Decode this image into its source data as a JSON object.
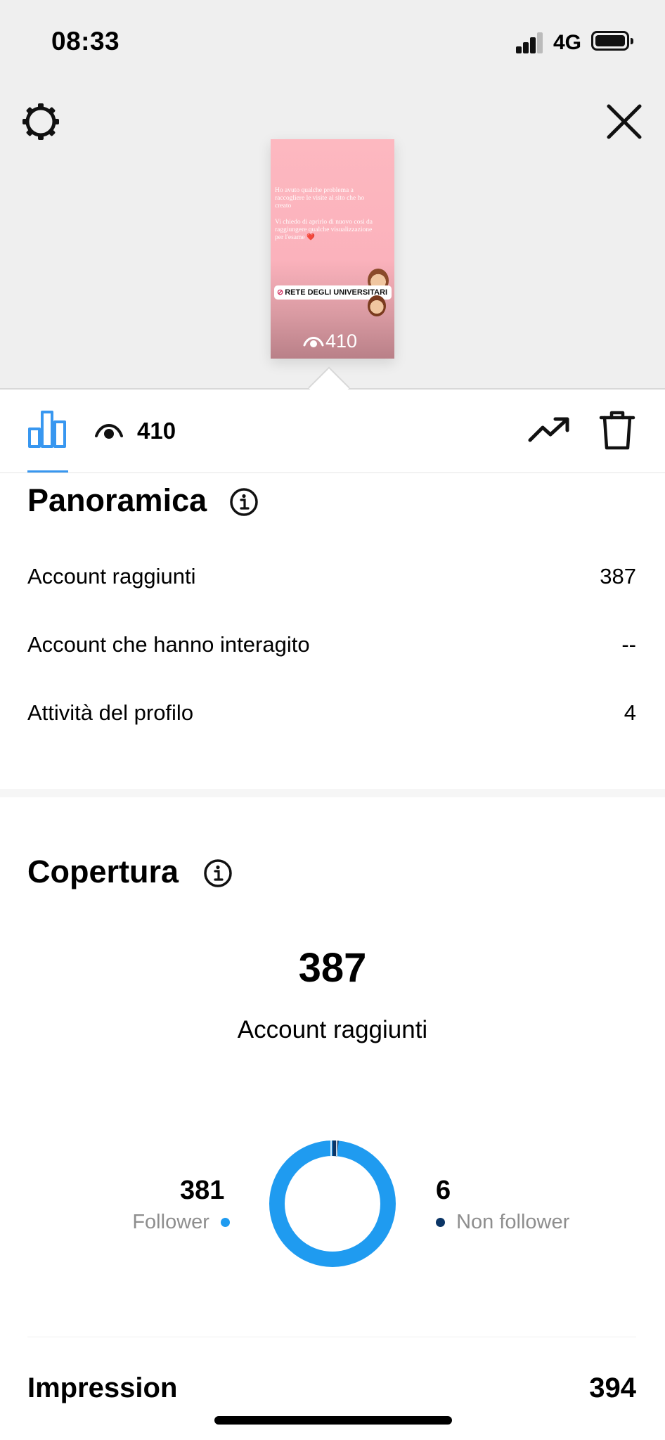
{
  "status_bar": {
    "time": "08:33",
    "network": "4G"
  },
  "story": {
    "text_lines": [
      "Ho avuto qualche problema a raccogliere le visite al sito che ho creato",
      "Vi chiedo di aprirlo di nuovo così da raggiungere qualche visualizzazione per l'esame ❤️"
    ],
    "sticker": "RETE DEGLI UNIVERSITARI",
    "views": "410"
  },
  "tabbar": {
    "views": "410"
  },
  "overview": {
    "title": "Panoramica",
    "rows": [
      {
        "label": "Account raggiunti",
        "value": "387"
      },
      {
        "label": "Account che hanno interagito",
        "value": "--"
      },
      {
        "label": "Attività del profilo",
        "value": "4"
      }
    ]
  },
  "reach": {
    "title": "Copertura",
    "total": "387",
    "total_label": "Account raggiunti",
    "followers": {
      "value": "381",
      "label": "Follower",
      "color": "#1f9bf0"
    },
    "non_followers": {
      "value": "6",
      "label": "Non follower",
      "color": "#0b3566"
    },
    "follower_fraction": 0.9845
  },
  "impressions": {
    "label": "Impression",
    "value": "394"
  },
  "colors": {
    "accent": "#3897f0",
    "background_top": "#efefef"
  }
}
